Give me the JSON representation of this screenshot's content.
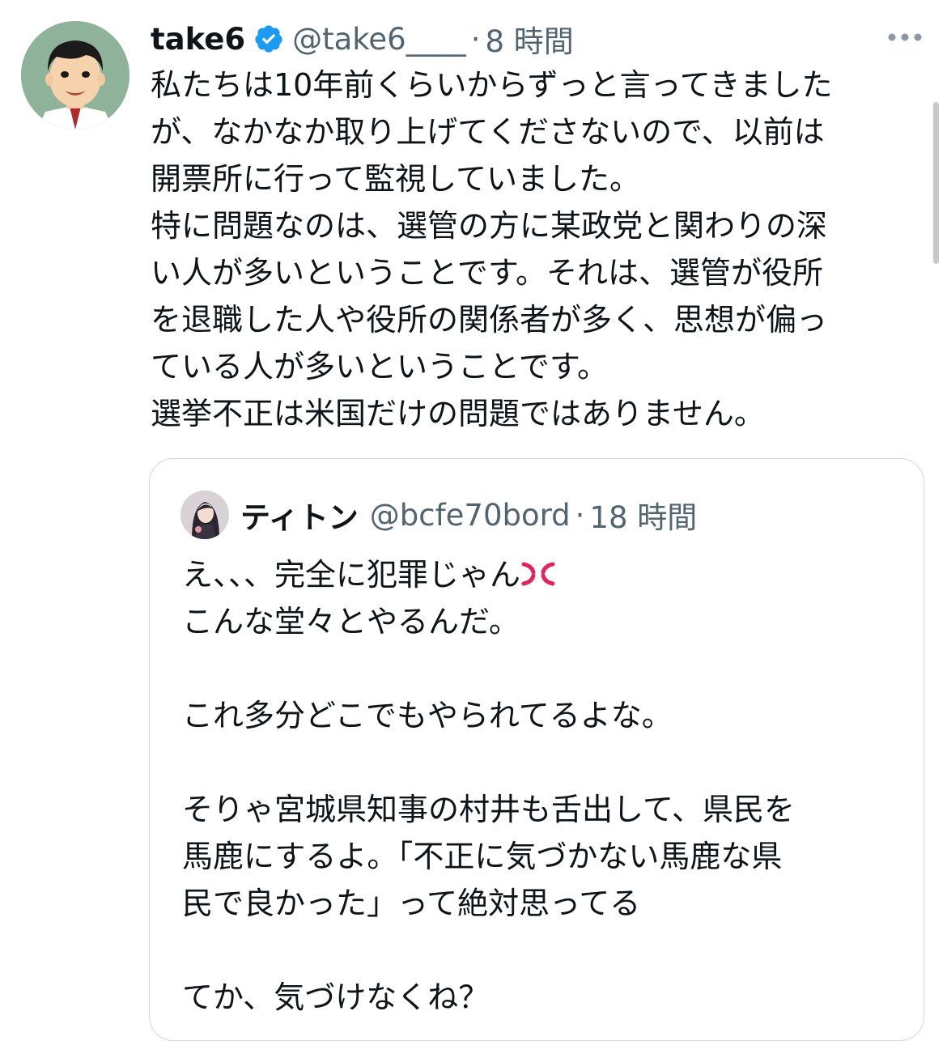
{
  "tweet": {
    "display_name": "take6",
    "handle": "@take6____",
    "dot": "·",
    "time": "8 時間",
    "verified_icon": "verified-badge-icon",
    "more_icon": "more-options-icon",
    "text_lines": [
      "私たちは10年前くらいからずっと言ってきました",
      "が、なかなか取り上げてくださないので、以前は",
      "開票所に行って監視していました。",
      "特に問題なのは、選管の方に某政党と関わりの深",
      "い人が多いということです。それは、選管が役所",
      "を退職した人や役所の関係者が多く、思想が偏っ",
      "ている人が多いということです。",
      "選挙不正は米国だけの問題ではありません。"
    ]
  },
  "quote": {
    "display_name": "ティトン",
    "handle": "@bcfe70bord",
    "dot": "·",
    "time": "18 時間",
    "emoji": "anger-symbol-icon",
    "line1": "え、、、完全に犯罪じゃん",
    "text_lines": [
      "こんな堂々とやるんだ。",
      "",
      "これ多分どこでもやられてるよな。",
      "",
      "そりゃ宮城県知事の村井も舌出して、県民を",
      "馬鹿にするよ。「不正に気づかない馬鹿な県",
      "民で良かった」って絶対思ってる",
      "",
      "てか、気づけなくね？"
    ]
  },
  "colors": {
    "text": "#0f1419",
    "secondary": "#536471",
    "verified": "#1d9bf0",
    "border": "#cfd9de",
    "anger": "#e0245e"
  }
}
